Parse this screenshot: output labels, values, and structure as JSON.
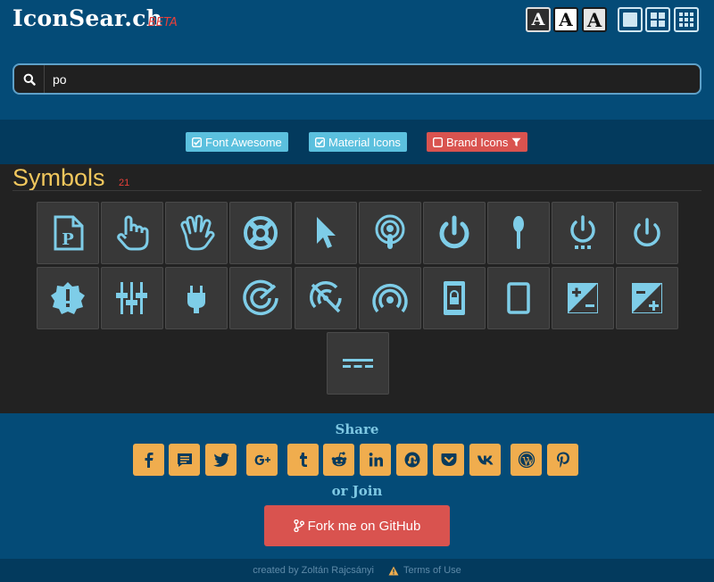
{
  "header": {
    "logo": "IconSear.ch",
    "beta": "BETA",
    "font_buttons": [
      "A",
      "A",
      "A"
    ],
    "layout_buttons": [
      "single-layout-icon",
      "quad-layout-icon",
      "grid-layout-icon"
    ]
  },
  "search": {
    "value": "po",
    "icon": "search-icon"
  },
  "filters": [
    {
      "label": "Font Awesome",
      "checked": true
    },
    {
      "label": "Material Icons",
      "checked": true
    },
    {
      "label": "Brand Icons",
      "checked": false
    }
  ],
  "section": {
    "title": "Symbols",
    "count": "21"
  },
  "icons": [
    "parking-file-icon",
    "hand-pointer-icon",
    "hand-spock-icon",
    "life-ring-icon",
    "mouse-pointer-icon",
    "podcast-icon",
    "power-off-icon",
    "spoon-icon",
    "power-settings-icon",
    "power-icon",
    "new-releases-icon",
    "tune-sliders-icon",
    "power-plug-icon",
    "track-changes-icon",
    "portable-wifi-off-icon",
    "wifi-tethering-icon",
    "phonelink-lock-icon",
    "tablet-icon",
    "exposure-icon",
    "exposure-plus-icon",
    "power-input-icon"
  ],
  "share": {
    "label": "Share",
    "join_label": "or Join",
    "buttons": [
      "facebook-icon",
      "comment-icon",
      "twitter-icon",
      "google-plus-icon",
      "tumblr-icon",
      "reddit-icon",
      "linkedin-icon",
      "stumbleupon-icon",
      "pocket-icon",
      "vk-icon",
      "wordpress-icon",
      "pinterest-icon"
    ]
  },
  "fork": {
    "label": "Fork me on GitHub"
  },
  "footer": {
    "credit": "created by Zoltán Rajcsányi",
    "terms": "Terms of Use"
  },
  "colors": {
    "header_bg": "#044b77",
    "filter_bg": "#033a5d",
    "content_bg": "#222222",
    "tile_bg": "#383838",
    "icon_color": "#7ecde8",
    "title_color": "#f1c75d",
    "accent_red": "#d9534f",
    "share_orange": "#f0ad4e",
    "filter_blue": "#5bc0de"
  }
}
